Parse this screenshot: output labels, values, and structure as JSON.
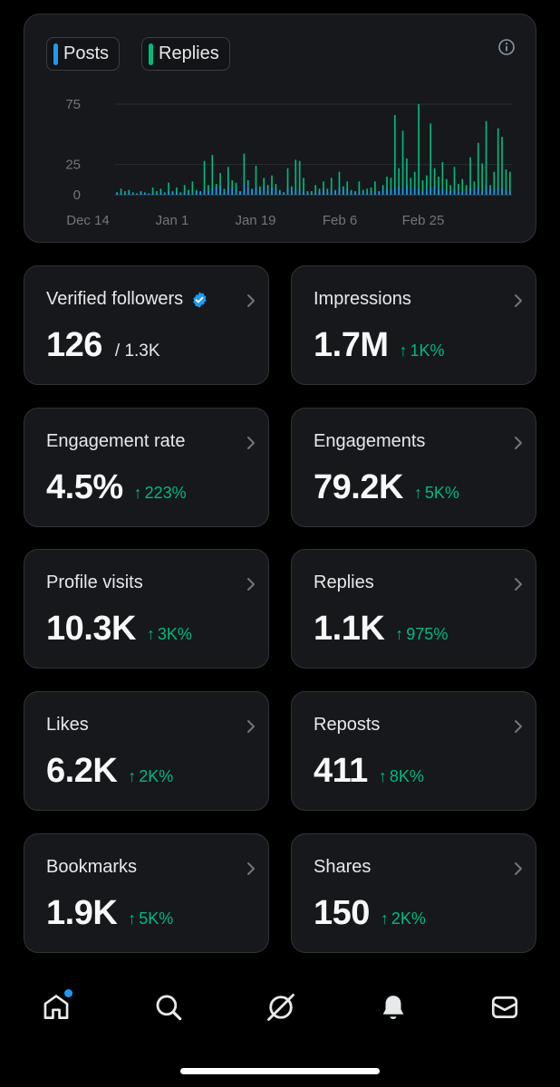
{
  "colors": {
    "posts": "#1d9bf0",
    "replies": "#00ba7c",
    "positive_change": "#00ba7c",
    "verified_badge": "#1d9bf0"
  },
  "legend": {
    "posts_label": "Posts",
    "replies_label": "Replies"
  },
  "chart_data": {
    "type": "bar",
    "series": [
      {
        "name": "Posts",
        "values": [
          2,
          1,
          1,
          2,
          1,
          1,
          2,
          1,
          1,
          1,
          1,
          2,
          1,
          3,
          2,
          2,
          1,
          2,
          1,
          1,
          3,
          2,
          4,
          3,
          5,
          6,
          8,
          2,
          7,
          5,
          4,
          3,
          9,
          6,
          4,
          6,
          3,
          7,
          4,
          6,
          5,
          3,
          2,
          6,
          3,
          5,
          4,
          3,
          2,
          1,
          2,
          3,
          5,
          2,
          4,
          3,
          6,
          4,
          5,
          3,
          2,
          3,
          2,
          1,
          3,
          2,
          3,
          4,
          5,
          4,
          6,
          7,
          5,
          8,
          4,
          6,
          5,
          3,
          4,
          6,
          7,
          4,
          5,
          3,
          3,
          4,
          2,
          3,
          2,
          5,
          4,
          6,
          3,
          7,
          5,
          4,
          6,
          5,
          4,
          3
        ]
      },
      {
        "name": "Replies",
        "values": [
          2,
          5,
          3,
          4,
          2,
          1,
          3,
          2,
          1,
          6,
          3,
          5,
          2,
          10,
          3,
          6,
          2,
          8,
          4,
          11,
          4,
          3,
          28,
          8,
          33,
          9,
          18,
          5,
          23,
          12,
          10,
          3,
          34,
          12,
          5,
          24,
          7,
          14,
          8,
          16,
          9,
          4,
          2,
          22,
          7,
          29,
          28,
          14,
          3,
          3,
          8,
          5,
          11,
          5,
          14,
          4,
          19,
          7,
          11,
          4,
          3,
          11,
          4,
          5,
          6,
          11,
          2,
          8,
          15,
          14,
          66,
          22,
          53,
          30,
          14,
          19,
          75,
          12,
          16,
          59,
          22,
          15,
          27,
          13,
          8,
          23,
          9,
          13,
          8,
          31,
          11,
          43,
          26,
          61,
          8,
          19,
          55,
          48,
          21,
          19
        ]
      }
    ],
    "x_tick_labels": [
      "Dec 14",
      "Jan 1",
      "Jan 19",
      "Feb 6",
      "Feb 25"
    ],
    "y_tick_labels": [
      "75",
      "25",
      "0"
    ],
    "ylim": [
      0,
      75
    ],
    "grid": true,
    "legend_position": "top-left"
  },
  "stats": [
    {
      "title": "Verified followers",
      "value": "126",
      "total": "/ 1.3K",
      "change": ""
    },
    {
      "title": "Impressions",
      "value": "1.7M",
      "change": "1K%"
    },
    {
      "title": "Engagement rate",
      "value": "4.5%",
      "change": "223%"
    },
    {
      "title": "Engagements",
      "value": "79.2K",
      "change": "5K%"
    },
    {
      "title": "Profile visits",
      "value": "10.3K",
      "change": "3K%"
    },
    {
      "title": "Replies",
      "value": "1.1K",
      "change": "975%"
    },
    {
      "title": "Likes",
      "value": "6.2K",
      "change": "2K%"
    },
    {
      "title": "Reposts",
      "value": "411",
      "change": "8K%"
    },
    {
      "title": "Bookmarks",
      "value": "1.9K",
      "change": "5K%"
    },
    {
      "title": "Shares",
      "value": "150",
      "change": "2K%"
    }
  ],
  "nav": {
    "items": [
      "home-icon",
      "search-icon",
      "grok-icon",
      "notifications-icon",
      "messages-icon"
    ],
    "home_has_notification": true
  },
  "arrow": "↑"
}
